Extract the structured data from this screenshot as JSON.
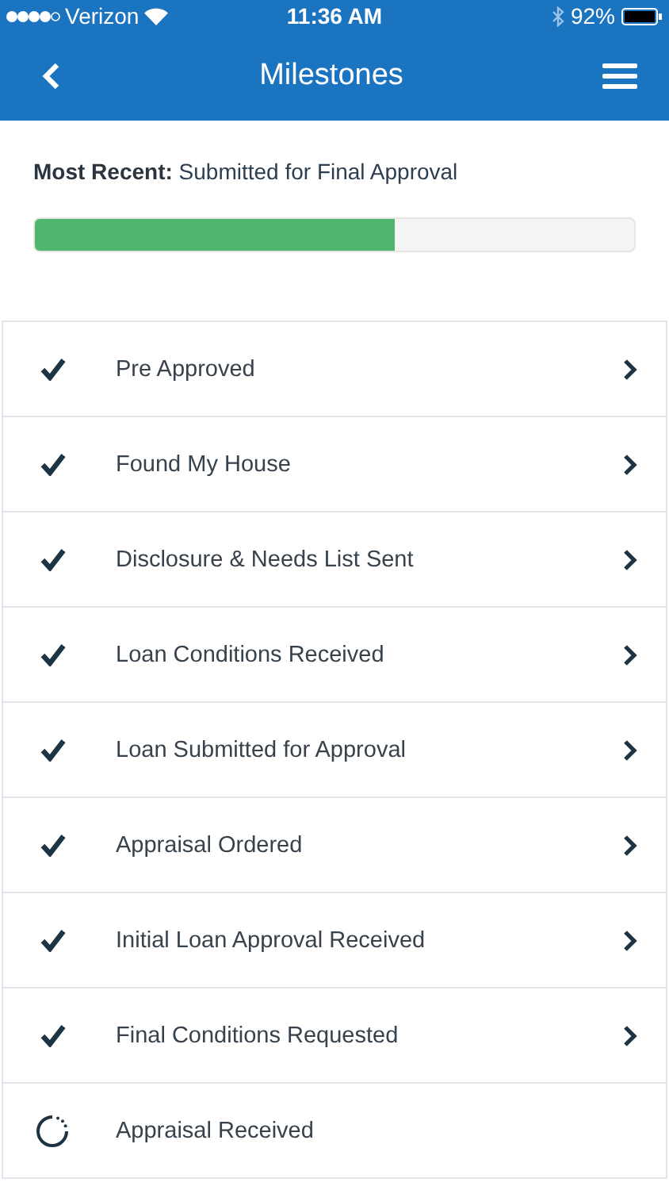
{
  "status_bar": {
    "carrier": "Verizon",
    "time": "11:36 AM",
    "battery": "92%"
  },
  "nav_bar": {
    "title": "Milestones"
  },
  "summary": {
    "label": "Most Recent:",
    "value": "Submitted for Final Approval",
    "progress": {
      "level": 0.6
    }
  },
  "milestones": [
    {
      "label": "Pre Approved",
      "completed": true
    },
    {
      "label": "Found My House",
      "completed": true
    },
    {
      "label": "Disclosure & Needs List Sent",
      "completed": true
    },
    {
      "label": "Loan Conditions Received",
      "completed": true
    },
    {
      "label": "Loan Submitted for Approval",
      "completed": true
    },
    {
      "label": "Appraisal Ordered",
      "completed": true
    },
    {
      "label": "Initial Loan Approval Received",
      "completed": true
    },
    {
      "label": "Final Conditions Requested",
      "completed": true
    },
    {
      "label": "Appraisal Received",
      "completed": false
    }
  ]
}
